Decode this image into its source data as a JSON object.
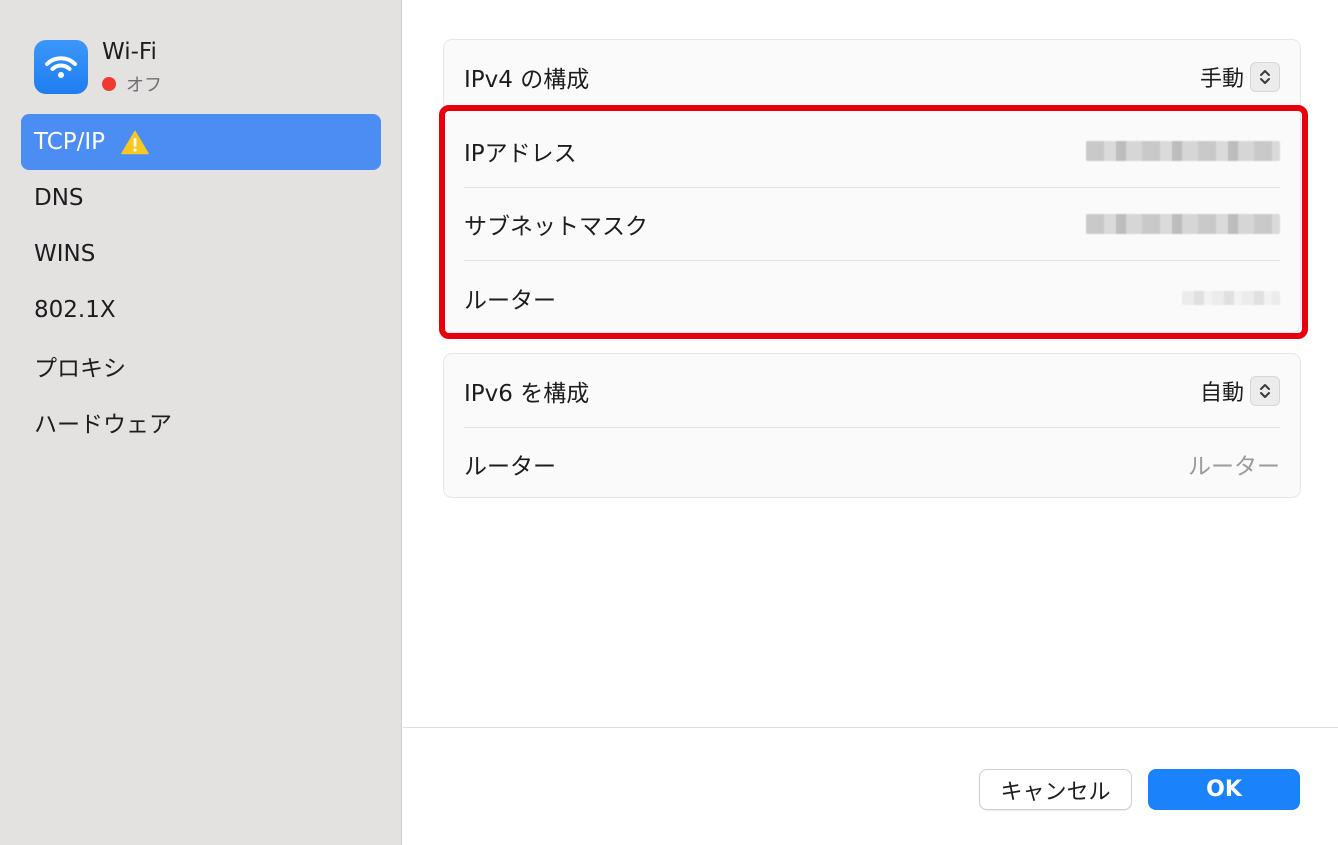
{
  "sidebar": {
    "network": {
      "name": "Wi-Fi",
      "status": "オフ",
      "status_color": "#f03a2f",
      "icon": "wifi-icon"
    },
    "items": [
      {
        "label": "TCP/IP",
        "selected": true,
        "warning_icon": "warning-icon"
      },
      {
        "label": "DNS"
      },
      {
        "label": "WINS"
      },
      {
        "label": "802.1X"
      },
      {
        "label": "プロキシ"
      },
      {
        "label": "ハードウェア"
      }
    ]
  },
  "ipv4": {
    "configure_label": "IPv4 の構成",
    "configure_value": "手動",
    "ip_address_label": "IPアドレス",
    "subnet_mask_label": "サブネットマスク",
    "router_label": "ルーター"
  },
  "ipv6": {
    "configure_label": "IPv6 を構成",
    "configure_value": "自動",
    "router_label": "ルーター",
    "router_placeholder": "ルーター"
  },
  "buttons": {
    "cancel": "キャンセル",
    "ok": "OK"
  },
  "colors": {
    "accent": "#1a82fb",
    "selection": "#4b8df2",
    "highlight": "#e8000b"
  }
}
